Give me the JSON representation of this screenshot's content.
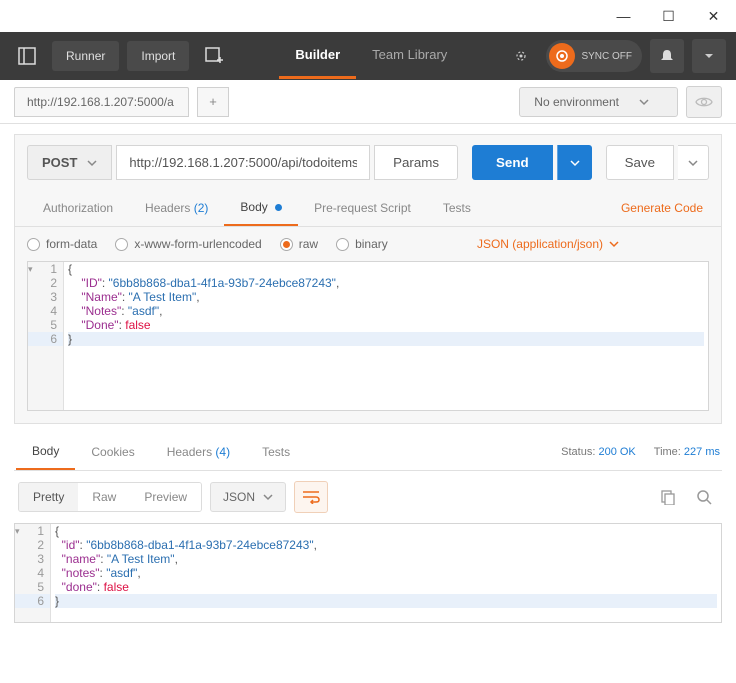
{
  "titlebar": {
    "min": "—",
    "max": "☐",
    "close": "✕"
  },
  "toolbar": {
    "runner": "Runner",
    "import": "Import",
    "tabs": {
      "builder": "Builder",
      "team_library": "Team Library"
    },
    "sync_off": "SYNC OFF"
  },
  "tabbar": {
    "tab1": "http://192.168.1.207:5000/a",
    "add": "+",
    "env": "No environment"
  },
  "request": {
    "method": "POST",
    "url": "http://192.168.1.207:5000/api/todoitems",
    "params": "Params",
    "send": "Send",
    "save": "Save",
    "tabs": {
      "authorization": "Authorization",
      "headers": "Headers",
      "headers_count": "(2)",
      "body": "Body",
      "prerequest": "Pre-request Script",
      "tests": "Tests"
    },
    "generate_code": "Generate Code",
    "body_types": {
      "form_data": "form-data",
      "xwww": "x-www-form-urlencoded",
      "raw": "raw",
      "binary": "binary",
      "json_dd": "JSON (application/json)"
    },
    "code": {
      "lines": [
        "1",
        "2",
        "3",
        "4",
        "5",
        "6"
      ],
      "l1_brace": "{",
      "l2_key": "\"ID\"",
      "l2_val": "\"6bb8b868-dba1-4f1a-93b7-24ebce87243\"",
      "l3_key": "\"Name\"",
      "l3_val": "\"A Test Item\"",
      "l4_key": "\"Notes\"",
      "l4_val": "\"asdf\"",
      "l5_key": "\"Done\"",
      "l5_val": "false",
      "l6_brace": "}"
    }
  },
  "response": {
    "tabs": {
      "body": "Body",
      "cookies": "Cookies",
      "headers": "Headers",
      "headers_count": "(4)",
      "tests": "Tests"
    },
    "status_label": "Status:",
    "status_val": "200 OK",
    "time_label": "Time:",
    "time_val": "227 ms",
    "view": {
      "pretty": "Pretty",
      "raw": "Raw",
      "preview": "Preview"
    },
    "format": "JSON",
    "code": {
      "lines": [
        "1",
        "2",
        "3",
        "4",
        "5",
        "6"
      ],
      "l1_brace": "{",
      "l2_key": "\"id\"",
      "l2_val": "\"6bb8b868-dba1-4f1a-93b7-24ebce87243\"",
      "l3_key": "\"name\"",
      "l3_val": "\"A Test Item\"",
      "l4_key": "\"notes\"",
      "l4_val": "\"asdf\"",
      "l5_key": "\"done\"",
      "l5_val": "false",
      "l6_brace": "}"
    }
  }
}
